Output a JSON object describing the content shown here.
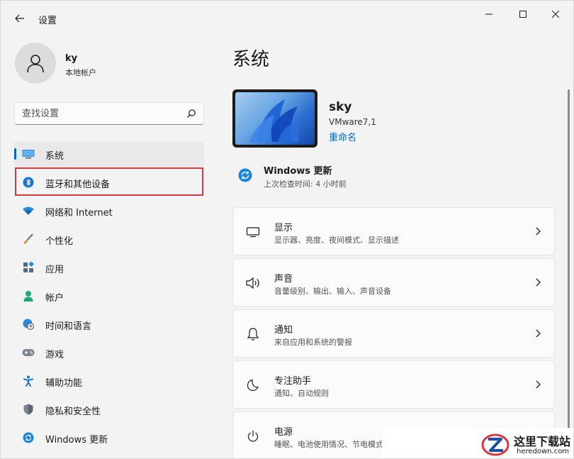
{
  "window": {
    "title": "设置"
  },
  "user": {
    "name": "ky",
    "account_type": "本地帐户"
  },
  "search": {
    "placeholder": "查找设置"
  },
  "nav": {
    "items": [
      {
        "label": "系统",
        "icon": "monitor-icon",
        "active": true
      },
      {
        "label": "蓝牙和其他设备",
        "icon": "bluetooth-icon",
        "active": false
      },
      {
        "label": "网络和 Internet",
        "icon": "wifi-icon",
        "active": false
      },
      {
        "label": "个性化",
        "icon": "brush-icon",
        "active": false
      },
      {
        "label": "应用",
        "icon": "apps-icon",
        "active": false
      },
      {
        "label": "帐户",
        "icon": "account-icon",
        "active": false
      },
      {
        "label": "时间和语言",
        "icon": "globe-clock-icon",
        "active": false
      },
      {
        "label": "游戏",
        "icon": "gamepad-icon",
        "active": false
      },
      {
        "label": "辅助功能",
        "icon": "accessibility-icon",
        "active": false
      },
      {
        "label": "隐私和安全性",
        "icon": "shield-icon",
        "active": false
      },
      {
        "label": "Windows 更新",
        "icon": "windows-update-icon",
        "active": false
      }
    ]
  },
  "main": {
    "title": "系统",
    "device": {
      "name": "sky",
      "model": "VMware7,1",
      "rename": "重命名"
    },
    "windows_update": {
      "title": "Windows 更新",
      "subtitle": "上次检查时间: 4 小时前"
    },
    "cards": [
      {
        "title": "显示",
        "desc": "显示器、亮度、夜间模式、显示描述",
        "icon": "display-icon"
      },
      {
        "title": "声音",
        "desc": "音量级别、输出、输入、声音设备",
        "icon": "speaker-icon"
      },
      {
        "title": "通知",
        "desc": "来自应用和系统的警报",
        "icon": "bell-icon"
      },
      {
        "title": "专注助手",
        "desc": "通知、自动规则",
        "icon": "moon-icon"
      },
      {
        "title": "电源",
        "desc": "睡眠、电池使用情况、节电模式",
        "icon": "power-icon"
      }
    ]
  },
  "watermark": {
    "text": "这里下载站",
    "url": "heredown.com"
  },
  "colors": {
    "accent": "#0067c0",
    "highlight": "#d9383e",
    "background": "#f3f3f3",
    "card": "#fbfbfb"
  }
}
